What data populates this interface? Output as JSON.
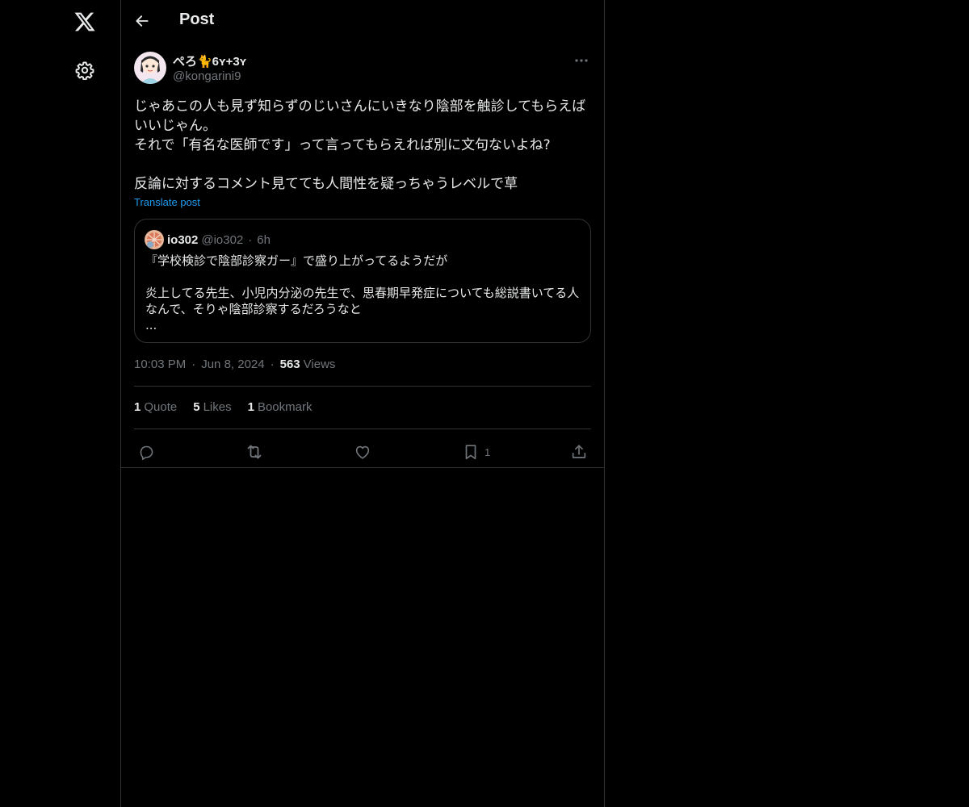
{
  "nav": {
    "logo_icon": "x-logo-icon",
    "settings_icon": "gear-icon"
  },
  "header": {
    "title": "Post",
    "back_icon": "arrow-left-icon"
  },
  "post": {
    "author_name": "ぺろ🐈6ʏ+3ʏ",
    "author_handle": "@kongarini9",
    "text": "じゃあこの人も見ず知らずのじいさんにいきなり陰部を触診してもらえばいいじゃん。\nそれで「有名な医師です」って言ってもらえれば別に文句ないよね?\n\n反論に対するコメント見てても人間性を疑っちゃうレベルで草",
    "translate_label": "Translate post",
    "time": "10:03 PM",
    "date": "Jun 8, 2024",
    "views_count": "563",
    "views_label": "Views",
    "separator": "·"
  },
  "quote": {
    "author_name": "io302",
    "author_handle": "@io302",
    "time": "6h",
    "text": "『学校検診で陰部診察ガー』で盛り上がってるようだが\n\n炎上してる先生、小児内分泌の先生で、思春期早発症についても総説書いてる人なんで、そりゃ陰部診察するだろうなと\n..."
  },
  "stats": [
    {
      "count": "1",
      "label": "Quote"
    },
    {
      "count": "5",
      "label": "Likes"
    },
    {
      "count": "1",
      "label": "Bookmark"
    }
  ],
  "actions": {
    "reply_icon": "reply-icon",
    "repost_icon": "repost-icon",
    "like_icon": "heart-icon",
    "bookmark_icon": "bookmark-icon",
    "bookmark_count": "1",
    "share_icon": "share-icon"
  },
  "colors": {
    "background": "#000000",
    "text": "#e7e9ea",
    "secondary": "#71767b",
    "link": "#1d9bf0",
    "border": "#2f3336"
  }
}
